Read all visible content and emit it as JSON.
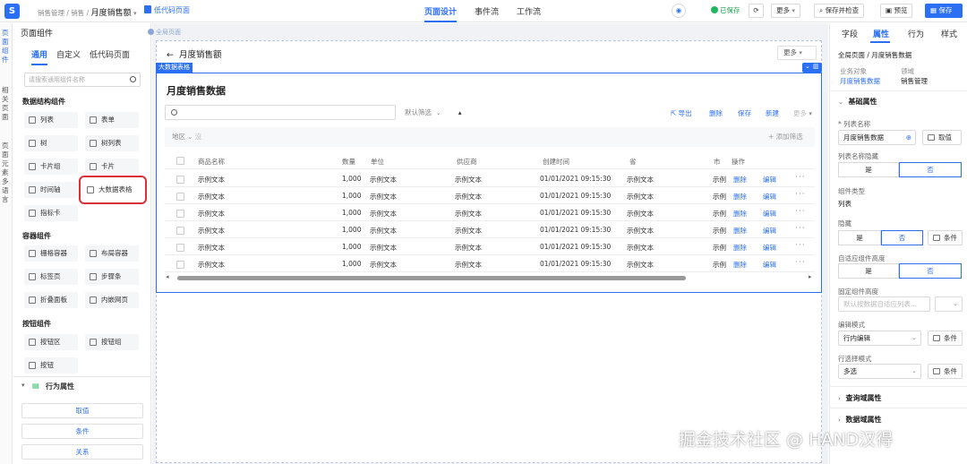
{
  "header": {
    "logo": "S",
    "breadcrumb": "销售管理 / 销售 /",
    "current_page": "月度销售额",
    "lowcode_label": "低代码页面",
    "tabs": [
      {
        "label": "页面设计"
      },
      {
        "label": "事件流"
      },
      {
        "label": "工作流"
      }
    ],
    "saved_label": "已保存",
    "more_label": "更多",
    "save_check_label": "保存并检查",
    "preview_label": "预览",
    "save_label": "保存"
  },
  "side_tabs": {
    "components": "页面组件",
    "related": "相关页面",
    "i18n": "页面元素多语言"
  },
  "left_panel": {
    "title": "页面组件",
    "tabs": [
      "通用",
      "自定义",
      "低代码页面"
    ],
    "search_placeholder": "请搜索通用组件名称",
    "groups": {
      "data_structure": "数据结构组件",
      "container": "容器组件",
      "button": "按钮组件"
    },
    "components": {
      "list": "列表",
      "form": "表单",
      "tree": "树",
      "tree_list": "树列表",
      "card_group": "卡片组",
      "card": "卡片",
      "timeline": "时间轴",
      "big_table": "大数据表格",
      "indicator_card": "指标卡",
      "grid_container": "栅格容器",
      "layout_container": "布局容器",
      "tab_page": "标签页",
      "steps": "步骤条",
      "collapse_panel": "折叠面板",
      "embedded_page": "内嵌网页",
      "button_area": "按钮区",
      "button_group": "按钮组",
      "button": "按钮"
    },
    "behavior_title": "行为属性",
    "behavior_buttons": [
      "取值",
      "条件",
      "关系"
    ]
  },
  "canvas": {
    "page_tag": "全局页面",
    "page_title": "月度销售额",
    "more_label": "更多",
    "component_tag": "大数据表格",
    "table_title": "月度销售数据",
    "filter_default": "默认筛选",
    "actions": {
      "export": "导出",
      "delete": "删除",
      "save": "保存",
      "new": "新建",
      "more": "更多"
    },
    "filter_area": "地区",
    "add_filter": "+ 添加筛选",
    "columns": [
      "商品名称",
      "数量",
      "单位",
      "供应商",
      "创建时间",
      "省",
      "市",
      "操作"
    ],
    "rows": [
      {
        "name": "示例文本",
        "qty": "1,000",
        "unit": "示例文本",
        "supplier": "示例文本",
        "created": "01/01/2021 09:15:30",
        "province": "示例文本",
        "city": "示例",
        "delete": "删除",
        "edit": "编辑"
      },
      {
        "name": "示例文本",
        "qty": "1,000",
        "unit": "示例文本",
        "supplier": "示例文本",
        "created": "01/01/2021 09:15:30",
        "province": "示例文本",
        "city": "示例",
        "delete": "删除",
        "edit": "编辑"
      },
      {
        "name": "示例文本",
        "qty": "1,000",
        "unit": "示例文本",
        "supplier": "示例文本",
        "created": "01/01/2021 09:15:30",
        "province": "示例文本",
        "city": "示例",
        "delete": "删除",
        "edit": "编辑"
      },
      {
        "name": "示例文本",
        "qty": "1,000",
        "unit": "示例文本",
        "supplier": "示例文本",
        "created": "01/01/2021 09:15:30",
        "province": "示例文本",
        "city": "示例",
        "delete": "删除",
        "edit": "编辑"
      },
      {
        "name": "示例文本",
        "qty": "1,000",
        "unit": "示例文本",
        "supplier": "示例文本",
        "created": "01/01/2021 09:15:30",
        "province": "示例文本",
        "city": "示例",
        "delete": "删除",
        "edit": "编辑"
      },
      {
        "name": "示例文本",
        "qty": "1,000",
        "unit": "示例文本",
        "supplier": "示例文本",
        "created": "01/01/2021 09:15:30",
        "province": "示例文本",
        "city": "示例",
        "delete": "删除",
        "edit": "编辑"
      }
    ]
  },
  "right_panel": {
    "tabs": [
      "字段",
      "属性",
      "行为",
      "样式"
    ],
    "path": "全局页面 / 月度销售数据",
    "business_object_label": "业务对象",
    "business_object_value": "月度销售数据",
    "domain_label": "领域",
    "domain_value": "销售管理",
    "basic_props": "基础属性",
    "list_name_label": "* 列表名称",
    "list_name_value": "月度销售数据",
    "take_value": "取值",
    "hide_name_label": "列表名称隐藏",
    "yes": "是",
    "no": "否",
    "component_type_label": "组件类型",
    "component_type_value": "列表",
    "hidden_label": "隐藏",
    "condition": "条件",
    "adaptive_height_label": "自适应组件高度",
    "fixed_height_label": "固定组件高度",
    "fixed_height_placeholder": "默认按数据自适应列表...",
    "edit_mode_label": "编辑模式",
    "edit_mode_value": "行内编辑",
    "row_select_label": "行选择模式",
    "row_select_value": "多选",
    "query_props": "查询域属性",
    "data_props": "数据域属性"
  },
  "watermark": "掘金技术社区 @ HAND汉得",
  "colors": {
    "accent": "#2b6ff3",
    "highlight": "#d9303a",
    "success": "#1fb85c"
  }
}
